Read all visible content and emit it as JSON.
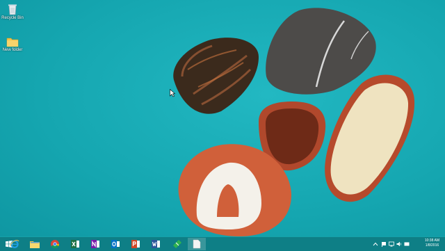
{
  "desktop": {
    "icons": [
      {
        "label": "Recycle Bin",
        "icon": "recycle-bin-icon"
      },
      {
        "label": "New folder",
        "icon": "folder-icon"
      }
    ]
  },
  "taskbar": {
    "start": "windows-start",
    "pinned": [
      {
        "name": "Internet Explorer",
        "icon": "internet-explorer-icon"
      },
      {
        "name": "File Explorer",
        "icon": "file-explorer-icon"
      },
      {
        "name": "Google Chrome",
        "icon": "chrome-icon"
      },
      {
        "name": "Excel",
        "icon": "excel-icon"
      },
      {
        "name": "OneNote",
        "icon": "onenote-icon"
      },
      {
        "name": "Outlook",
        "icon": "outlook-icon"
      },
      {
        "name": "PowerPoint",
        "icon": "powerpoint-icon"
      },
      {
        "name": "Word",
        "icon": "word-icon"
      },
      {
        "name": "App",
        "icon": "app-icon"
      },
      {
        "name": "Document",
        "icon": "document-icon"
      }
    ],
    "clock": {
      "time": "10:38 AM",
      "date": "1/8/2016"
    }
  }
}
